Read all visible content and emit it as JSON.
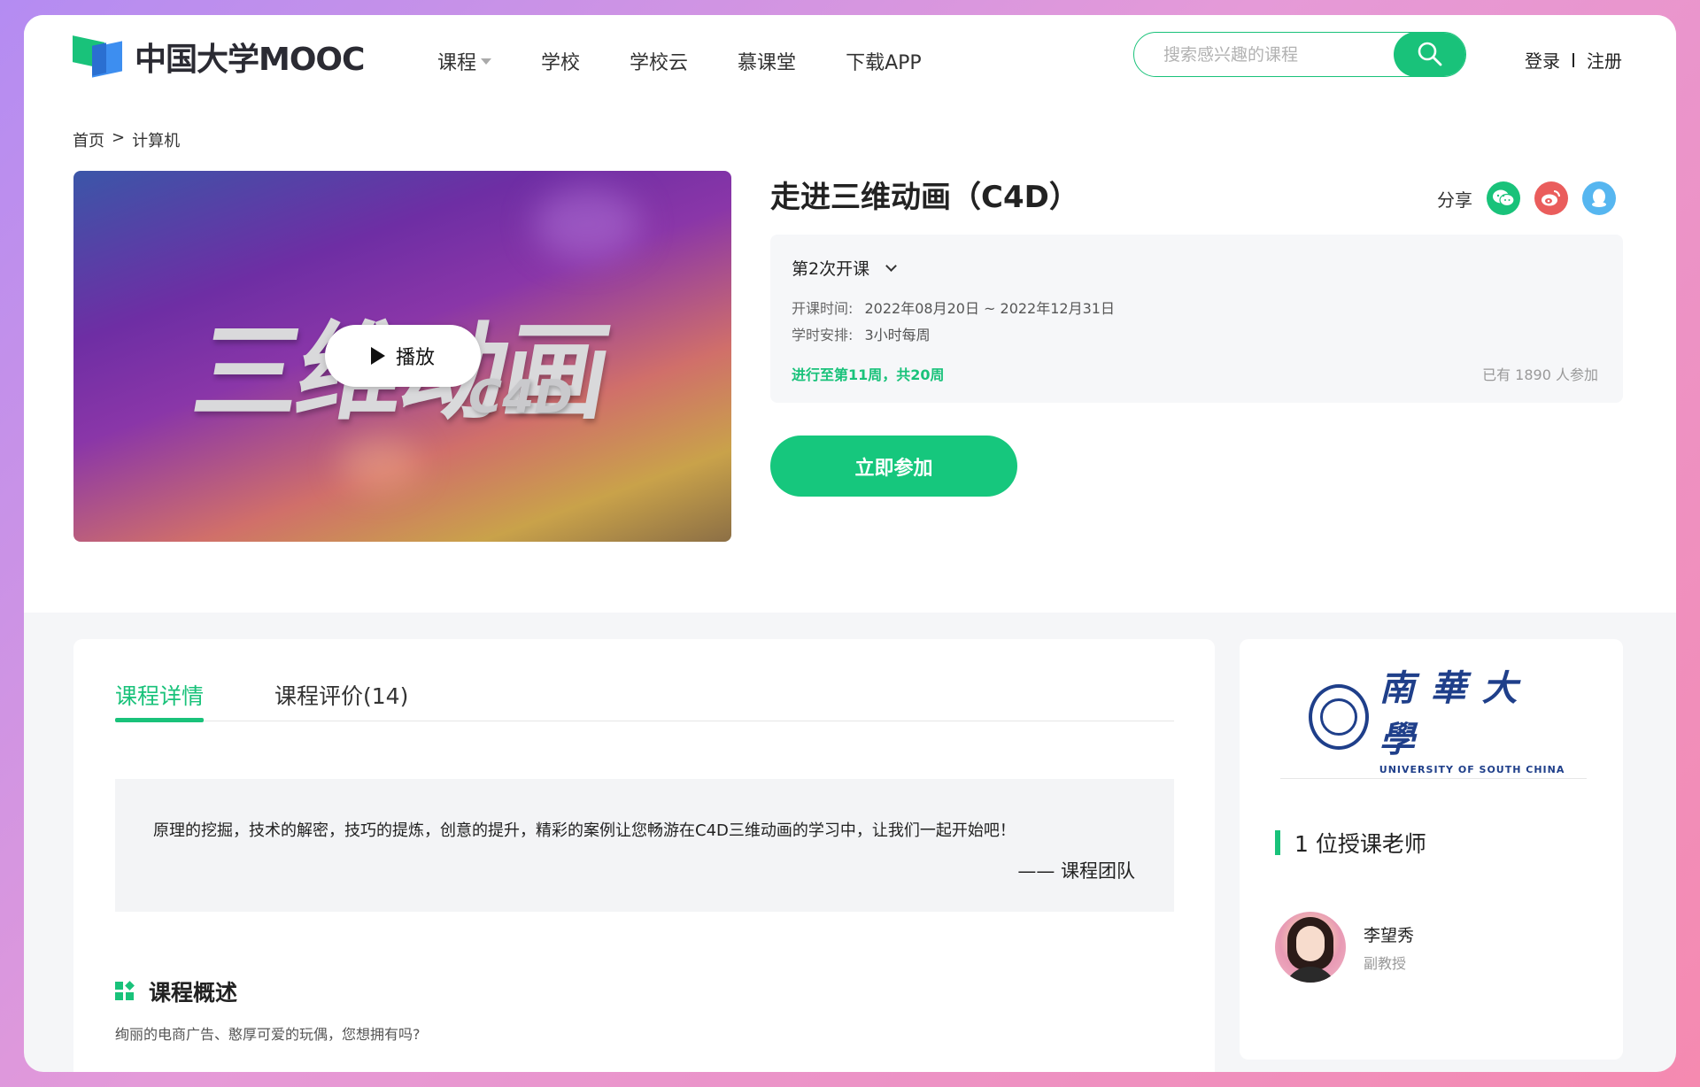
{
  "header": {
    "logo_text": "中国大学MOOC",
    "nav": [
      {
        "label": "课程",
        "dropdown": true
      },
      {
        "label": "学校"
      },
      {
        "label": "学校云"
      },
      {
        "label": "慕课堂"
      },
      {
        "label": "下载APP"
      }
    ],
    "search": {
      "placeholder": "搜索感兴趣的课程"
    },
    "login": "登录",
    "register": "注册"
  },
  "breadcrumb": {
    "home": "首页",
    "separator": ">",
    "current": "计算机"
  },
  "video": {
    "title_art": "三维动画",
    "subtitle_art": "C4D",
    "play_label": "播放"
  },
  "course": {
    "title": "走进三维动画（C4D）",
    "share_label": "分享",
    "share_icons": [
      "wechat-icon",
      "weibo-icon",
      "qq-icon"
    ],
    "term_label": "第2次开课",
    "schedule_label": "开课时间:",
    "schedule_value": "2022年08月20日 ~ 2022年12月31日",
    "hours_label": "学时安排:",
    "hours_value": "3小时每周",
    "progress": "进行至第11周，共20周",
    "enrolled": "已有 1890 人参加",
    "join_label": "立即参加"
  },
  "detail": {
    "tabs": [
      {
        "label": "课程详情",
        "active": true
      },
      {
        "label": "课程评价(14)",
        "active": false
      }
    ],
    "quote": "原理的挖掘，技术的解密，技巧的提炼，创意的提升，精彩的案例让您畅游在C4D三维动画的学习中，让我们一起开始吧！",
    "quote_by": "—— 课程团队",
    "overview_title": "课程概述",
    "overview_text": "绚丽的电商广告、憨厚可爱的玩偶，您想拥有吗?"
  },
  "side": {
    "university_cn": "南華大學",
    "university_en": "UNIVERSITY OF SOUTH CHINA",
    "teachers_heading": "1 位授课老师",
    "teacher": {
      "name": "李望秀",
      "title": "副教授"
    }
  },
  "colors": {
    "accent": "#19c27a",
    "join_button": "#16c77d",
    "weibo": "#ea5d5c",
    "qq": "#56b6f0"
  }
}
